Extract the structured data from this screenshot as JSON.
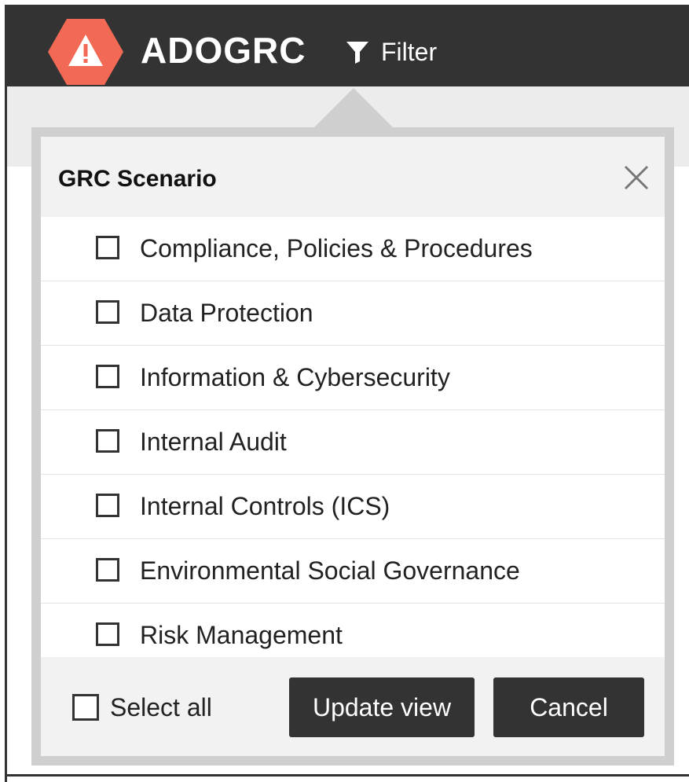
{
  "header": {
    "brand": "ADOGRC",
    "logo_icon": "warning-icon",
    "filter_icon": "filter-icon",
    "filter_label": "Filter",
    "colors": {
      "bar": "#333333",
      "logo": "#f26a55"
    }
  },
  "popup": {
    "title": "GRC Scenario",
    "close_icon": "close-icon",
    "options": [
      {
        "label": "Compliance, Policies & Procedures",
        "checked": false
      },
      {
        "label": "Data Protection",
        "checked": false
      },
      {
        "label": "Information & Cybersecurity",
        "checked": false
      },
      {
        "label": "Internal Audit",
        "checked": false
      },
      {
        "label": "Internal Controls (ICS)",
        "checked": false
      },
      {
        "label": "Environmental Social Governance",
        "checked": false
      },
      {
        "label": "Risk Management",
        "checked": false
      }
    ],
    "footer": {
      "select_all_label": "Select all",
      "update_label": "Update view",
      "cancel_label": "Cancel"
    }
  }
}
